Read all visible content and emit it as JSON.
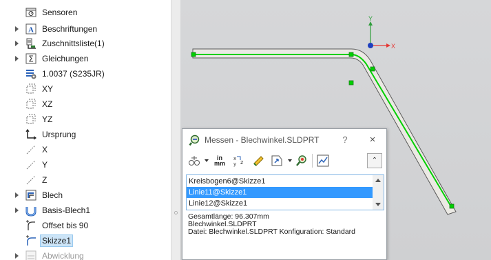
{
  "feature_tree": {
    "items": [
      {
        "label": "Sensoren",
        "icon": "sensor-icon",
        "expandable": false
      },
      {
        "label": "Beschriftungen",
        "icon": "annotations-icon",
        "expandable": true
      },
      {
        "label": "Zuschnittsliste(1)",
        "icon": "cut-list-icon",
        "expandable": true
      },
      {
        "label": "Gleichungen",
        "icon": "equations-icon",
        "expandable": true
      },
      {
        "label": "1.0037 (S235JR)",
        "icon": "material-icon",
        "expandable": false
      },
      {
        "label": "XY",
        "icon": "plane-icon",
        "expandable": false
      },
      {
        "label": "XZ",
        "icon": "plane-icon",
        "expandable": false
      },
      {
        "label": "YZ",
        "icon": "plane-icon",
        "expandable": false
      },
      {
        "label": "Ursprung",
        "icon": "origin-icon",
        "expandable": false
      },
      {
        "label": "X",
        "icon": "axis-icon",
        "expandable": false
      },
      {
        "label": "Y",
        "icon": "axis-icon",
        "expandable": false
      },
      {
        "label": "Z",
        "icon": "axis-icon",
        "expandable": false
      },
      {
        "label": "Blech",
        "icon": "sheet-metal-icon",
        "expandable": true
      },
      {
        "label": "Basis-Blech1",
        "icon": "base-flange-icon",
        "expandable": true
      },
      {
        "label": "Offset bis 90",
        "icon": "bend-icon",
        "expandable": false
      },
      {
        "label": "Skizze1",
        "icon": "sketch-icon",
        "expandable": false,
        "selected": true
      },
      {
        "label": "Abwicklung",
        "icon": "flat-pattern-icon",
        "expandable": true,
        "faded": true
      }
    ]
  },
  "triad": {
    "y_label": "Y",
    "x_label": "X"
  },
  "measure_dialog": {
    "title": "Messen - Blechwinkel.SLDPRT",
    "help_label": "?",
    "close_label": "×",
    "units_label_top": "in",
    "units_label_bottom": "mm",
    "collapse_label": "⌃",
    "selections": [
      {
        "label": "Kreisbogen6@Skizze1",
        "active": false
      },
      {
        "label": "Linie11@Skizze1",
        "active": true
      },
      {
        "label": "Linie12@Skizze1",
        "active": false
      }
    ],
    "results": [
      "Gesamtlänge: 96.307mm",
      "Blechwinkel.SLDPRT",
      "Datei: Blechwinkel.SLDPRT Konfiguration: Standard"
    ]
  },
  "colors": {
    "sketch_green": "#00d000",
    "selection_blue": "#3399ff",
    "triad_x": "#e53935",
    "triad_y": "#2e9d3a",
    "triad_z": "#1e3fbf"
  }
}
